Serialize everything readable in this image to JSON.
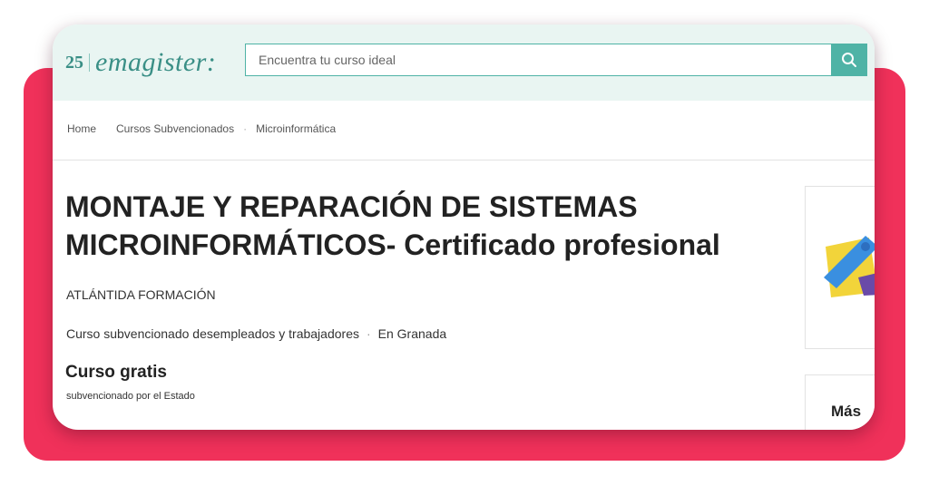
{
  "logo": {
    "number": "25",
    "word": "emagister:"
  },
  "search": {
    "placeholder": "Encuentra tu curso ideal"
  },
  "breadcrumb": {
    "home": "Home",
    "category": "Cursos Subvencionados",
    "subcategory": "Microinformática"
  },
  "course": {
    "title": "MONTAJE Y REPARACIÓN DE SISTEMAS MICROINFORMÁTICOS- Certificado profesional",
    "provider": "ATLÁNTIDA FORMACIÓN",
    "type": "Curso subvencionado desempleados y trabajadores",
    "location": "En Granada",
    "price": "Curso gratis",
    "subsidy": "subvencionado por el Estado"
  },
  "sidebar": {
    "box_title": "Más"
  },
  "colors": {
    "accent": "#4fb3a6",
    "header_bg": "#e9f5f2",
    "backdrop": "#f0315a",
    "logo": "#3a8f86"
  },
  "icons": {
    "search": "search-icon"
  }
}
